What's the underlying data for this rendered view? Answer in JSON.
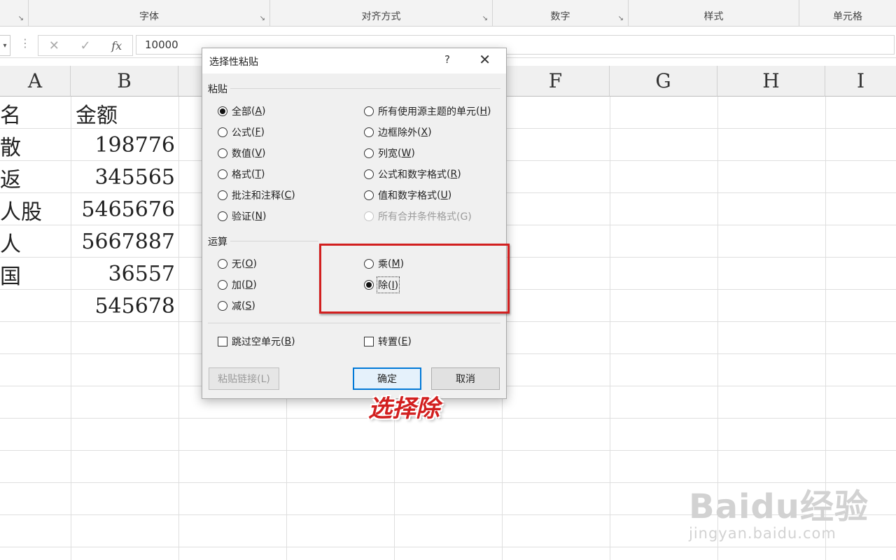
{
  "ribbon": {
    "groups": [
      {
        "label": "字体",
        "launcher": "↘"
      },
      {
        "label": "对齐方式",
        "launcher": "↘"
      },
      {
        "label": "数字",
        "launcher": "↘"
      },
      {
        "label": "样式",
        "launcher": ""
      },
      {
        "label": "单元格",
        "launcher": ""
      }
    ],
    "left_launcher": "↘"
  },
  "formula_bar": {
    "cancel_glyph": "✕",
    "enter_glyph": "✓",
    "fx_label": "fx",
    "value": "10000"
  },
  "sheet": {
    "columns": [
      "A",
      "B",
      "F",
      "G",
      "H",
      "I"
    ],
    "col_a": [
      "名",
      "散",
      "返",
      "人股",
      "人",
      "国",
      ""
    ],
    "col_b": [
      "金额",
      "198776",
      "345565",
      "5465676",
      "5667887",
      "36557",
      "545678"
    ]
  },
  "dialog": {
    "title": "选择性粘贴",
    "help": "?",
    "close": "✕",
    "paste_section": "粘贴",
    "paste_left": [
      {
        "label": "全部",
        "key": "A",
        "selected": true
      },
      {
        "label": "公式",
        "key": "F",
        "selected": false
      },
      {
        "label": "数值",
        "key": "V",
        "selected": false
      },
      {
        "label": "格式",
        "key": "T",
        "selected": false
      },
      {
        "label": "批注和注释",
        "key": "C",
        "selected": false
      },
      {
        "label": "验证",
        "key": "N",
        "selected": false
      }
    ],
    "paste_right": [
      {
        "label": "所有使用源主题的单元",
        "key": "H",
        "selected": false
      },
      {
        "label": "边框除外",
        "key": "X",
        "selected": false
      },
      {
        "label": "列宽",
        "key": "W",
        "selected": false
      },
      {
        "label": "公式和数字格式",
        "key": "R",
        "selected": false
      },
      {
        "label": "值和数字格式",
        "key": "U",
        "selected": false
      }
    ],
    "paste_disabled": "所有合并条件格式(G)",
    "operation_section": "运算",
    "op_left": [
      {
        "label": "无",
        "key": "O",
        "selected": false
      },
      {
        "label": "加",
        "key": "D",
        "selected": false
      },
      {
        "label": "减",
        "key": "S",
        "selected": false
      }
    ],
    "op_right": [
      {
        "label": "乘",
        "key": "M",
        "selected": false
      },
      {
        "label": "除",
        "key": "I",
        "selected": true
      }
    ],
    "skip_blanks": {
      "label": "跳过空单元",
      "key": "B",
      "checked": false
    },
    "transpose": {
      "label": "转置",
      "key": "E",
      "checked": false
    },
    "paste_link": "粘贴链接(L)",
    "ok": "确定",
    "cancel": "取消"
  },
  "annotation": {
    "text": "选择除",
    "color": "#d21f1f"
  },
  "watermark": {
    "brand": "Baidu经验",
    "url": "jingyan.baidu.com"
  }
}
